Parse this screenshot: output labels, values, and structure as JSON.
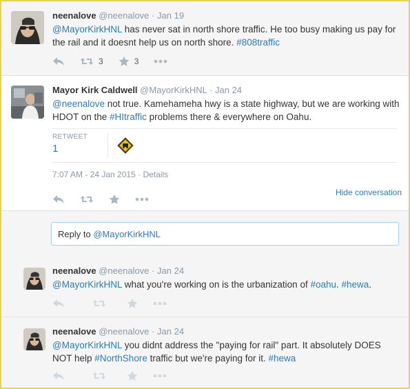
{
  "tweets": [
    {
      "name": "neenalove",
      "handle": "@neenalove",
      "sep": "·",
      "date": "Jan 19",
      "text_parts": [
        {
          "t": "@MayorKirkHNL",
          "link": true
        },
        {
          "t": " has never sat in north shore traffic. He too busy making us pay for the rail and it doesnt help us on north shore. ",
          "link": false
        },
        {
          "t": "#808traffic",
          "link": true
        }
      ],
      "retweet_count": "3",
      "favorite_count": "3"
    },
    {
      "name": "Mayor Kirk Caldwell",
      "handle": "@MayorKirkHNL",
      "sep": "·",
      "date": "Jan 24",
      "text_parts": [
        {
          "t": "@neenalove",
          "link": true
        },
        {
          "t": " not true. Kamehameha hwy is a state highway, but we are working with HDOT on the ",
          "link": false
        },
        {
          "t": "#HItraffic",
          "link": true
        },
        {
          "t": " problems there & everywhere on Oahu.",
          "link": false
        }
      ],
      "retweet_label": "RETWEET",
      "retweet_count": "1",
      "timestamp": "7:07 AM - 24 Jan 2015",
      "timestamp_sep": "·",
      "details_label": "Details",
      "hide_conversation": "Hide conversation"
    },
    {
      "name": "neenalove",
      "handle": "@neenalove",
      "sep": "·",
      "date": "Jan 24",
      "text_parts": [
        {
          "t": "@MayorKirkHNL",
          "link": true
        },
        {
          "t": " what you're working on is the urbanization of ",
          "link": false
        },
        {
          "t": "#oahu",
          "link": true
        },
        {
          "t": ". ",
          "link": false
        },
        {
          "t": "#hewa",
          "link": true
        },
        {
          "t": ".",
          "link": false
        }
      ]
    },
    {
      "name": "neenalove",
      "handle": "@neenalove",
      "sep": "·",
      "date": "Jan 24",
      "text_parts": [
        {
          "t": "@MayorKirkHNL",
          "link": true
        },
        {
          "t": " you didnt address the \"paying for rail\" part. It absolutely DOES NOT help ",
          "link": false
        },
        {
          "t": "#NorthShore",
          "link": true
        },
        {
          "t": " traffic but we're paying for it. ",
          "link": false
        },
        {
          "t": "#hewa",
          "link": true
        }
      ]
    }
  ],
  "reply_box": {
    "prefix": "Reply to ",
    "mention": "@MayorKirkHNL"
  },
  "icons": {
    "reply": "reply-arrow-icon",
    "retweet": "retweet-icon",
    "favorite": "star-icon",
    "more": "more-dots-icon",
    "traffic": "traffic-sign-icon"
  },
  "colors": {
    "link": "#2b7bb9",
    "muted": "#8899a6",
    "frame": "#e8d34a"
  }
}
